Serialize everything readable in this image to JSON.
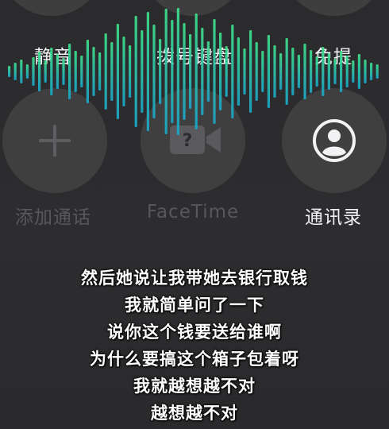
{
  "call_controls": {
    "mute": {
      "label": "静音",
      "icon": "mute-icon"
    },
    "keypad": {
      "label": "拨号键盘",
      "icon": "keypad-icon"
    },
    "speaker": {
      "label": "免提",
      "icon": "speaker-icon"
    },
    "add_call": {
      "label": "添加通话",
      "icon": "plus-icon",
      "enabled": false
    },
    "facetime": {
      "label": "FaceTime",
      "icon": "facetime-icon",
      "enabled": false
    },
    "contacts": {
      "label": "通讯录",
      "icon": "contacts-icon",
      "enabled": true
    }
  },
  "subtitles": [
    "然后她说让我带她去银行取钱",
    "我就简单问了一下",
    "说你这个钱要送给谁啊",
    "为什么要搞这个箱子包着呀",
    "我就越想越不对",
    "越想越不对"
  ],
  "colors": {
    "wave_top": "#3ee08a",
    "wave_bottom": "#1aa6c8",
    "background": "#2c2c2e"
  }
}
